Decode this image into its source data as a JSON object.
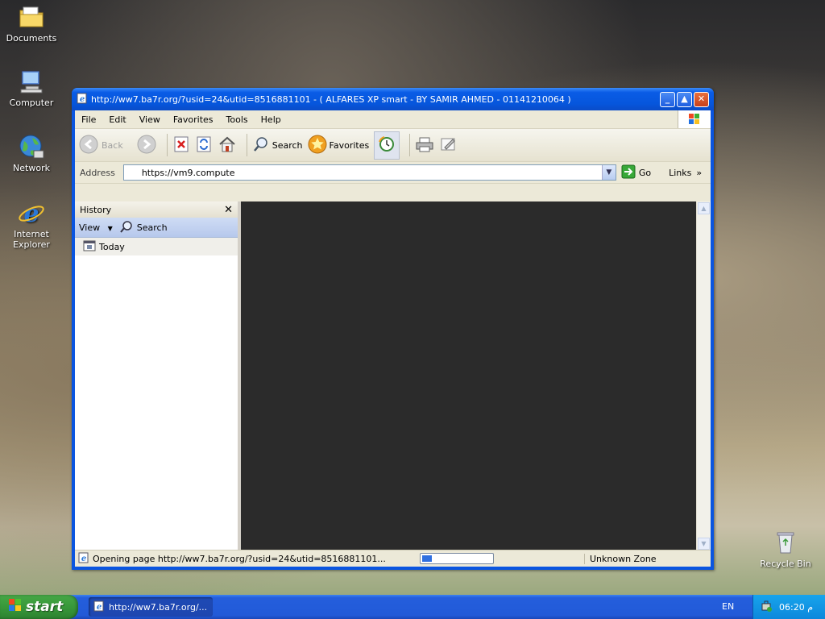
{
  "desktop": {
    "icons": [
      {
        "label": "Documents"
      },
      {
        "label": "Computer"
      },
      {
        "label": "Network"
      },
      {
        "label": "Internet\nExplorer",
        "l1": "Internet",
        "l2": "Explorer"
      },
      {
        "label": "Recycle Bin"
      }
    ]
  },
  "window": {
    "title": "http://ww7.ba7r.org/?usid=24&utid=8516881101 - ( ALFARES XP smart  -  BY SAMIR AHMED - 01141210064 )",
    "menu": [
      "File",
      "Edit",
      "View",
      "Favorites",
      "Tools",
      "Help"
    ],
    "toolbar": {
      "back": "Back",
      "search": "Search",
      "favorites": "Favorites"
    },
    "address": {
      "label": "Address",
      "value": "https://vm9.compute",
      "go": "Go",
      "links": "Links"
    },
    "sidebar": {
      "title": "History",
      "view": "View",
      "search": "Search",
      "items": [
        "Today"
      ]
    },
    "status": {
      "text": "Opening page http://ww7.ba7r.org/?usid=24&utid=8516881101...",
      "progress": 0.15,
      "zone": "Unknown Zone"
    }
  },
  "taskbar": {
    "start": "start",
    "task_label": "http://ww7.ba7r.org/...",
    "lang": "EN",
    "clock": "06:20 م"
  }
}
